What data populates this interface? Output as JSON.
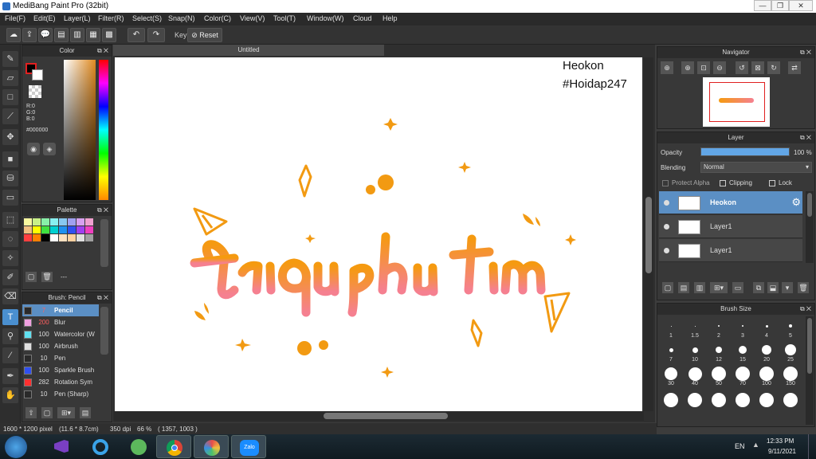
{
  "app": {
    "title": "MediBang Paint Pro (32bit)"
  },
  "menu": [
    "File(F)",
    "Edit(E)",
    "Layer(L)",
    "Filter(R)",
    "Select(S)",
    "Snap(N)",
    "Color(C)",
    "View(V)",
    "Tool(T)",
    "Window(W)",
    "Cloud",
    "Help"
  ],
  "toolbar": {
    "key_label": "Key",
    "reset_label": "Reset"
  },
  "color_panel": {
    "title": "Color",
    "r": "R:0",
    "g": "G:0",
    "b": "B:0",
    "hex": "#000000"
  },
  "palette_panel": {
    "title": "Palette",
    "footer_text": "---",
    "colors": [
      "#f9f9a0",
      "#c8f088",
      "#88f0a8",
      "#88f0f0",
      "#88c8f0",
      "#a0a0f0",
      "#d8a0f0",
      "#f0a0d0",
      "#f0c080",
      "#ffff00",
      "#40e040",
      "#00d0d0",
      "#2090f0",
      "#3050f0",
      "#a040f0",
      "#f040c0",
      "#ff4040",
      "#ff8000",
      "#000000",
      "#ffffff",
      "#ffe0c0",
      "#ffd0a0",
      "#e0e0e0",
      "#a0a0a0"
    ]
  },
  "brush_panel": {
    "title": "Brush: Pencil",
    "items": [
      {
        "size": "7",
        "name": "Pencil",
        "color": "#2a2a2a",
        "selected": true
      },
      {
        "size": "200",
        "name": "Blur",
        "color": "#f0a0e0"
      },
      {
        "size": "100",
        "name": "Watercolor (W",
        "color": "#60e0f0"
      },
      {
        "size": "100",
        "name": "Airbrush",
        "color": "#e0e0e0"
      },
      {
        "size": "10",
        "name": "Pen",
        "color": "#2a2a2a"
      },
      {
        "size": "100",
        "name": "Sparkle Brush",
        "color": "#3050f0"
      },
      {
        "size": "282",
        "name": "Rotation Sym",
        "color": "#ff3030"
      },
      {
        "size": "10",
        "name": "Pen (Sharp)",
        "color": "#2a2a2a"
      }
    ]
  },
  "document": {
    "tab_title": "Untitled",
    "watermark_line1": "Heokon",
    "watermark_line2": "#Hoidap247"
  },
  "navigator_panel": {
    "title": "Navigator"
  },
  "layer_panel": {
    "title": "Layer",
    "opacity_label": "Opacity",
    "opacity_value": "100 %",
    "opacity_fraction": 1.0,
    "blending_label": "Blending",
    "blending_value": "Normal",
    "protect_alpha_label": "Protect Alpha",
    "clipping_label": "Clipping",
    "lock_label": "Lock",
    "layers": [
      {
        "name": "Heokon",
        "selected": true
      },
      {
        "name": "Layer1"
      },
      {
        "name": "Layer1"
      }
    ]
  },
  "brush_size_panel": {
    "title": "Brush Size",
    "sizes": [
      "1",
      "1.5",
      "2",
      "3",
      "4",
      "5",
      "7",
      "10",
      "12",
      "15",
      "20",
      "25",
      "30",
      "40",
      "50",
      "70",
      "100",
      "150",
      "",
      "",
      "",
      "",
      "",
      ""
    ]
  },
  "status": {
    "dimensions": "1600 * 1200 pixel",
    "physical": "(11.6 * 8.7cm)",
    "dpi": "350 dpi",
    "zoom": "66 %",
    "coords": "( 1357, 1003 )"
  },
  "taskbar": {
    "language": "EN",
    "time": "12:33 PM",
    "date": "9/11/2021",
    "zalo_label": "Zalo"
  },
  "colors": {
    "accent": "#4a8fcf",
    "orange": "#f29a12",
    "pink": "#f47f8c"
  }
}
